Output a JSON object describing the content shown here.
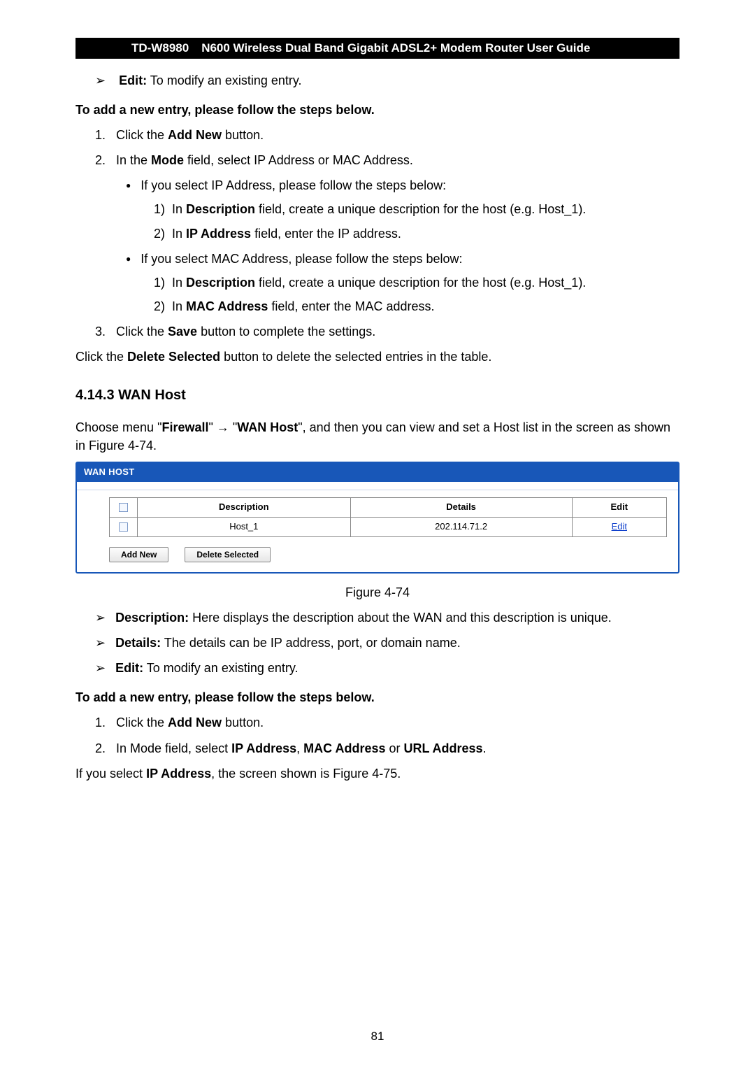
{
  "header": {
    "model": "TD-W8980",
    "title": "N600 Wireless Dual Band Gigabit ADSL2+ Modem Router User Guide"
  },
  "top_edit": {
    "label": "Edit:",
    "text": " To modify an existing entry."
  },
  "add_intro": "To add a new entry, please follow the steps below.",
  "steps1": {
    "s1_pre": "Click the ",
    "s1_b": "Add New",
    "s1_post": " button.",
    "s2_pre": "In the ",
    "s2_b": "Mode",
    "s2_post": " field, select IP Address or MAC Address.",
    "ip_intro": "If you select IP Address, please follow the steps below:",
    "ip_1_pre": "In ",
    "ip_1_b": "Description",
    "ip_1_post": " field, create a unique description for the host (e.g. Host_1).",
    "ip_2_pre": "In ",
    "ip_2_b": "IP Address",
    "ip_2_post": " field, enter the IP address.",
    "mac_intro": "If you select MAC Address, please follow the steps below:",
    "mac_1_pre": "In ",
    "mac_1_b": "Description",
    "mac_1_post": " field, create a unique description for the host (e.g. Host_1).",
    "mac_2_pre": "In ",
    "mac_2_b": "MAC Address",
    "mac_2_post": " field, enter the MAC address.",
    "s3_pre": "Click the ",
    "s3_b": "Save",
    "s3_post": " button to complete the settings."
  },
  "delete_line_pre": "Click the ",
  "delete_line_b": "Delete Selected",
  "delete_line_post": " button to delete the selected entries in the table.",
  "section_heading": "4.14.3 WAN Host",
  "choose_pre": "Choose menu \"",
  "choose_firewall": "Firewall",
  "choose_mid": "\"  →  \"",
  "choose_wan": "WAN Host",
  "choose_post": "\", and then you can view and set a Host list in the screen as shown in Figure 4-74.",
  "wan_panel": {
    "title": "WAN HOST",
    "cols": {
      "desc": "Description",
      "details": "Details",
      "edit": "Edit"
    },
    "row": {
      "desc": "Host_1",
      "details": "202.114.71.2",
      "edit": "Edit"
    },
    "btn_add": "Add New",
    "btn_del": "Delete Selected"
  },
  "figure_caption": "Figure 4-74",
  "defs": {
    "d1_b": "Description:",
    "d1_t": " Here displays the description about the WAN and this description is unique.",
    "d2_b": "Details:",
    "d2_t": " The details can be IP address, port, or domain name.",
    "d3_b": "Edit:",
    "d3_t": " To modify an existing entry."
  },
  "add_intro2": "To add a new entry, please follow the steps below.",
  "steps2": {
    "s1_pre": "Click the ",
    "s1_b": "Add New",
    "s1_post": " button.",
    "s2_pre": "In Mode field, select ",
    "s2_b1": "IP Address",
    "s2_m1": ", ",
    "s2_b2": "MAC Address",
    "s2_m2": " or ",
    "s2_b3": "URL Address",
    "s2_post": "."
  },
  "ip_select_line_pre": "If you select ",
  "ip_select_line_b": "IP Address",
  "ip_select_line_post": ", the screen shown is Figure 4-75.",
  "page_number": "81"
}
